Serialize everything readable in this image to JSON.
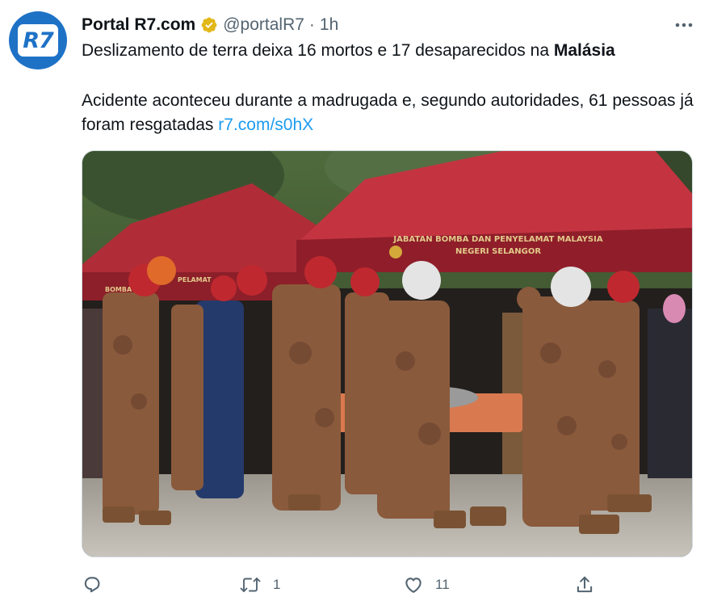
{
  "tweet": {
    "author_name": "Portal R7.com",
    "handle": "@portalR7",
    "separator": "·",
    "time": "1h",
    "avatar_text": "R7",
    "text_line1_prefix": "Deslizamento de terra deixa 16 mortos e 17 desaparecidos na ",
    "text_line1_bold": "Malásia",
    "text_para2": "Acidente aconteceu durante a madrugada e, segundo autoridades, 61 pessoas já foram resgatadas ",
    "link": "r7.com/s0hX",
    "tent_banner_line1": "JABATAN BOMBA DAN PENYELAMAT MALAYSIA",
    "tent_banner_line2": "NEGERI SELANGOR",
    "tent_left_line1": "BOMBA",
    "tent_left_line2": "PELAMAT"
  },
  "actions": {
    "reply_count": "",
    "retweet_count": "1",
    "like_count": "11"
  },
  "colors": {
    "accent": "#1d9bf0",
    "verified_badge": "#e2b719",
    "secondary_text": "#536471",
    "avatar_bg": "#1e72c6"
  },
  "icons": [
    "verified-badge-icon",
    "more-icon",
    "reply-icon",
    "retweet-icon",
    "like-icon",
    "share-icon"
  ]
}
